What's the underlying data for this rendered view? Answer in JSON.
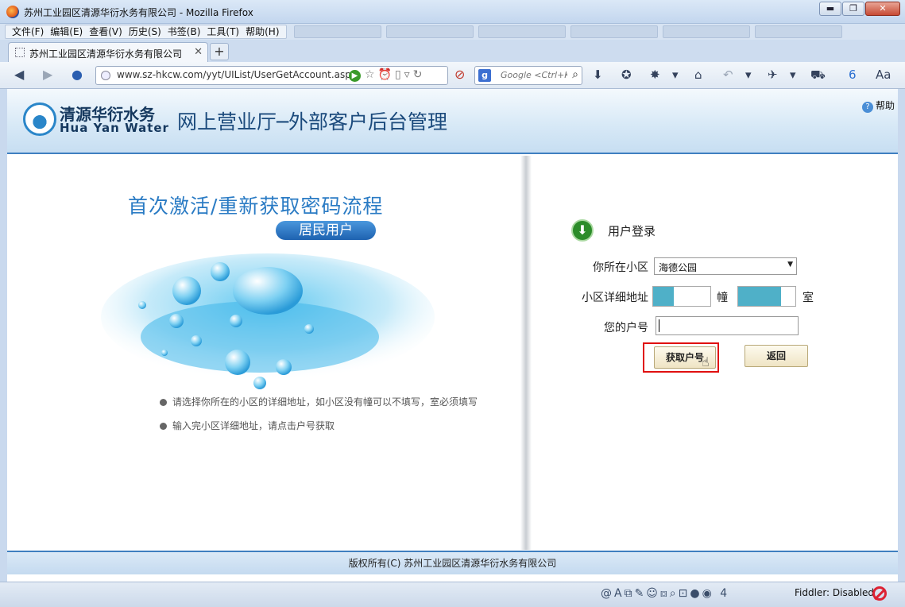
{
  "window": {
    "title": "苏州工业园区清源华衍水务有限公司 - Mozilla Firefox",
    "minimize": "▬",
    "maximize": "❐",
    "close": "✕"
  },
  "menu": [
    "文件(F)",
    "编辑(E)",
    "查看(V)",
    "历史(S)",
    "书签(B)",
    "工具(T)",
    "帮助(H)"
  ],
  "tab": {
    "label": "苏州工业园区清源华衍水务有限公司",
    "close": "✕",
    "new_tab": "+"
  },
  "nav": {
    "url": "www.sz-hkcw.com/yyt/UIList/UserGetAccount.aspx",
    "search_placeholder": "Google <Ctrl+K>"
  },
  "header": {
    "logo_cn": "清源华衍水务",
    "logo_en": "Hua Yan Water",
    "title": "网上营业厅─外部客户后台管理",
    "help": "帮助"
  },
  "left": {
    "flow_title": "首次激活/重新获取密码流程",
    "badge": "居民用户",
    "notes": [
      "请选择你所在的小区的详细地址，如小区没有幢可以不填写，室必须填写",
      "输入完小区详细地址，请点击户号获取"
    ]
  },
  "login": {
    "title": "用户登录",
    "community_label": "你所在小区",
    "community_value": "海德公园",
    "address_label": "小区详细地址",
    "building_unit": "幢",
    "room_unit": "室",
    "account_label": "您的户号",
    "get_button": "获取户号",
    "back_button": "返回"
  },
  "footer": {
    "copyright": "版权所有(C) 苏州工业园区清源华衍水务有限公司"
  },
  "status": {
    "count": "4",
    "fiddler": "Fiddler: Disabled"
  },
  "colors": {
    "accent": "#3f7fc0",
    "highlight": "#e01010",
    "field_fill": "#4fb0c8"
  }
}
